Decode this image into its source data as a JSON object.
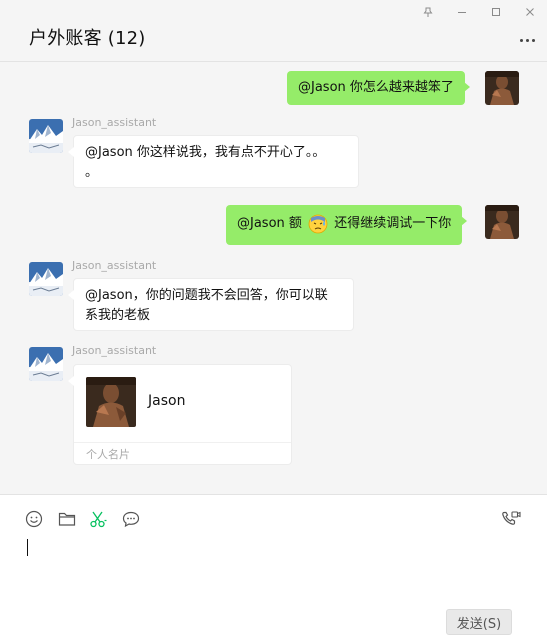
{
  "window": {
    "title": "户外账客 (12)",
    "controls": [
      "pin-icon",
      "minimize-icon",
      "maximize-icon",
      "close-icon"
    ]
  },
  "messages": [
    {
      "sender": "self",
      "text": "@Jason 你怎么越来越笨了"
    },
    {
      "sender": "Jason_assistant",
      "text_line1": "@Jason 你这样说我，我有点不开心了。。",
      "text_line2": "。"
    },
    {
      "sender": "self",
      "text_before": "@Jason 额",
      "emoji": "sweat-emoji",
      "text_after": "还得继续调试一下你"
    },
    {
      "sender": "Jason_assistant",
      "text_line1": "@Jason，你的问题我不会回答，你可以联",
      "text_line2": "系我的老板"
    },
    {
      "sender": "Jason_assistant",
      "type": "contact-card",
      "card_name": "Jason",
      "card_label": "个人名片"
    }
  ],
  "toolbar": {
    "icons": [
      "emoji-icon",
      "folder-icon",
      "scissors-icon",
      "chat-bubble-icon",
      "video-call-icon"
    ]
  },
  "send_button": "发送(S)",
  "colors": {
    "self_bubble": "#95ec69",
    "other_bubble": "#ffffff",
    "background": "#f5f5f5",
    "accent": "#07c160"
  }
}
